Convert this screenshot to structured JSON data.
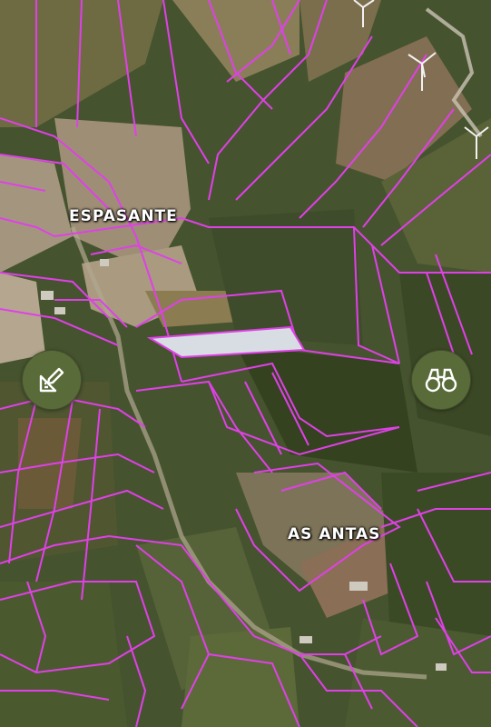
{
  "map": {
    "labels": {
      "espasante": "ESPASANTE",
      "as_antas": "AS ANTAS"
    },
    "buttons": {
      "measure": {
        "icon": "ruler-pencil-icon"
      },
      "view": {
        "icon": "binoculars-icon"
      }
    },
    "colors": {
      "parcel_border": "#e040e8",
      "selected_parcel_fill": "#d8dde4",
      "button_bg": "#5a6b3a",
      "label_text": "#ffffff"
    }
  }
}
